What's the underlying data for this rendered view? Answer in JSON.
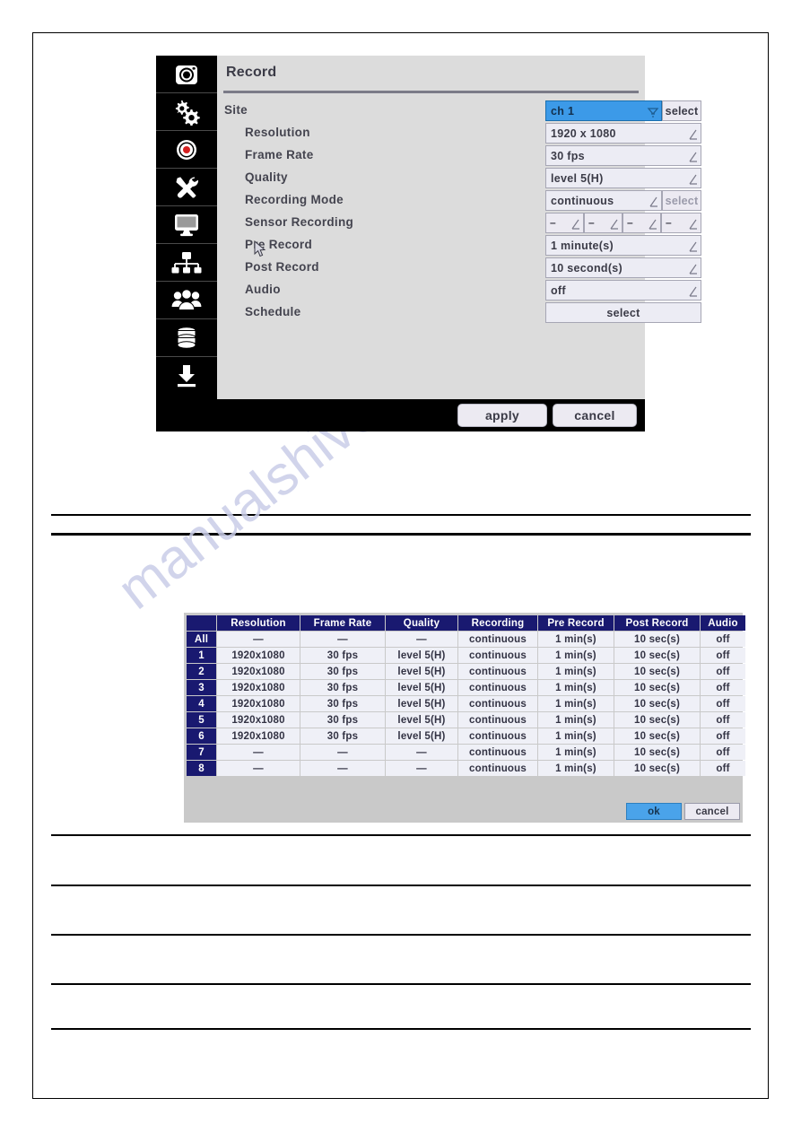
{
  "watermark": {
    "text": "manualshive.com"
  },
  "osd": {
    "title": "Record",
    "sidebar": [
      {
        "name": "camera-icon",
        "label": "Camera"
      },
      {
        "name": "gears-icon",
        "label": "System"
      },
      {
        "name": "record-icon",
        "label": "Record"
      },
      {
        "name": "tools-icon",
        "label": "Device"
      },
      {
        "name": "monitor-icon",
        "label": "Display"
      },
      {
        "name": "network-icon",
        "label": "Network"
      },
      {
        "name": "users-icon",
        "label": "User"
      },
      {
        "name": "database-icon",
        "label": "Storage"
      },
      {
        "name": "download-icon",
        "label": "Backup"
      }
    ],
    "rows": [
      {
        "label": "Site",
        "value": "ch 1",
        "widget": "dropdown-select",
        "select_label": "select",
        "selected": true
      },
      {
        "label": "Resolution",
        "value": "1920 x 1080",
        "widget": "edit"
      },
      {
        "label": "Frame Rate",
        "value": "30 fps",
        "widget": "edit"
      },
      {
        "label": "Quality",
        "value": "level 5(H)",
        "widget": "edit"
      },
      {
        "label": "Recording Mode",
        "value": "continuous",
        "widget": "edit-select",
        "select_label": "select"
      },
      {
        "label": "Sensor Recording",
        "value": "–",
        "widget": "sensor4",
        "cells": [
          "–",
          "–",
          "–",
          "–"
        ]
      },
      {
        "label": "Pre Record",
        "value": "1 minute(s)",
        "widget": "edit"
      },
      {
        "label": "Post Record",
        "value": "10 second(s)",
        "widget": "edit"
      },
      {
        "label": "Audio",
        "value": "off",
        "widget": "edit"
      },
      {
        "label": "Schedule",
        "value": "select",
        "widget": "button"
      }
    ],
    "buttons": {
      "apply": "apply",
      "cancel": "cancel"
    },
    "colors": {
      "panel_bg": "#dcdcdc",
      "chrome": "#000000",
      "highlight": "#3c9ae8",
      "field_bg": "#eceaf2"
    }
  },
  "channel_table": {
    "columns": [
      "",
      "Resolution",
      "Frame Rate",
      "Quality",
      "Recording",
      "Pre Record",
      "Post Record",
      "Audio"
    ],
    "rows": [
      {
        "ch": "All",
        "resolution": "—",
        "frame_rate": "—",
        "quality": "—",
        "recording": "continuous",
        "pre_record": "1 min(s)",
        "post_record": "10 sec(s)",
        "audio": "off"
      },
      {
        "ch": "1",
        "resolution": "1920x1080",
        "frame_rate": "30 fps",
        "quality": "level 5(H)",
        "recording": "continuous",
        "pre_record": "1 min(s)",
        "post_record": "10 sec(s)",
        "audio": "off"
      },
      {
        "ch": "2",
        "resolution": "1920x1080",
        "frame_rate": "30 fps",
        "quality": "level 5(H)",
        "recording": "continuous",
        "pre_record": "1 min(s)",
        "post_record": "10 sec(s)",
        "audio": "off"
      },
      {
        "ch": "3",
        "resolution": "1920x1080",
        "frame_rate": "30 fps",
        "quality": "level 5(H)",
        "recording": "continuous",
        "pre_record": "1 min(s)",
        "post_record": "10 sec(s)",
        "audio": "off"
      },
      {
        "ch": "4",
        "resolution": "1920x1080",
        "frame_rate": "30 fps",
        "quality": "level 5(H)",
        "recording": "continuous",
        "pre_record": "1 min(s)",
        "post_record": "10 sec(s)",
        "audio": "off"
      },
      {
        "ch": "5",
        "resolution": "1920x1080",
        "frame_rate": "30 fps",
        "quality": "level 5(H)",
        "recording": "continuous",
        "pre_record": "1 min(s)",
        "post_record": "10 sec(s)",
        "audio": "off"
      },
      {
        "ch": "6",
        "resolution": "1920x1080",
        "frame_rate": "30 fps",
        "quality": "level 5(H)",
        "recording": "continuous",
        "pre_record": "1 min(s)",
        "post_record": "10 sec(s)",
        "audio": "off"
      },
      {
        "ch": "7",
        "resolution": "—",
        "frame_rate": "—",
        "quality": "—",
        "recording": "continuous",
        "pre_record": "1 min(s)",
        "post_record": "10 sec(s)",
        "audio": "off"
      },
      {
        "ch": "8",
        "resolution": "—",
        "frame_rate": "—",
        "quality": "—",
        "recording": "continuous",
        "pre_record": "1 min(s)",
        "post_record": "10 sec(s)",
        "audio": "off"
      }
    ],
    "buttons": {
      "ok": "ok",
      "cancel": "cancel"
    },
    "colors": {
      "header_bg": "#191970",
      "cell_bg": "#eff0f7",
      "ok_bg": "#4aa3ea",
      "frame_bg": "#c9c9c9"
    }
  }
}
